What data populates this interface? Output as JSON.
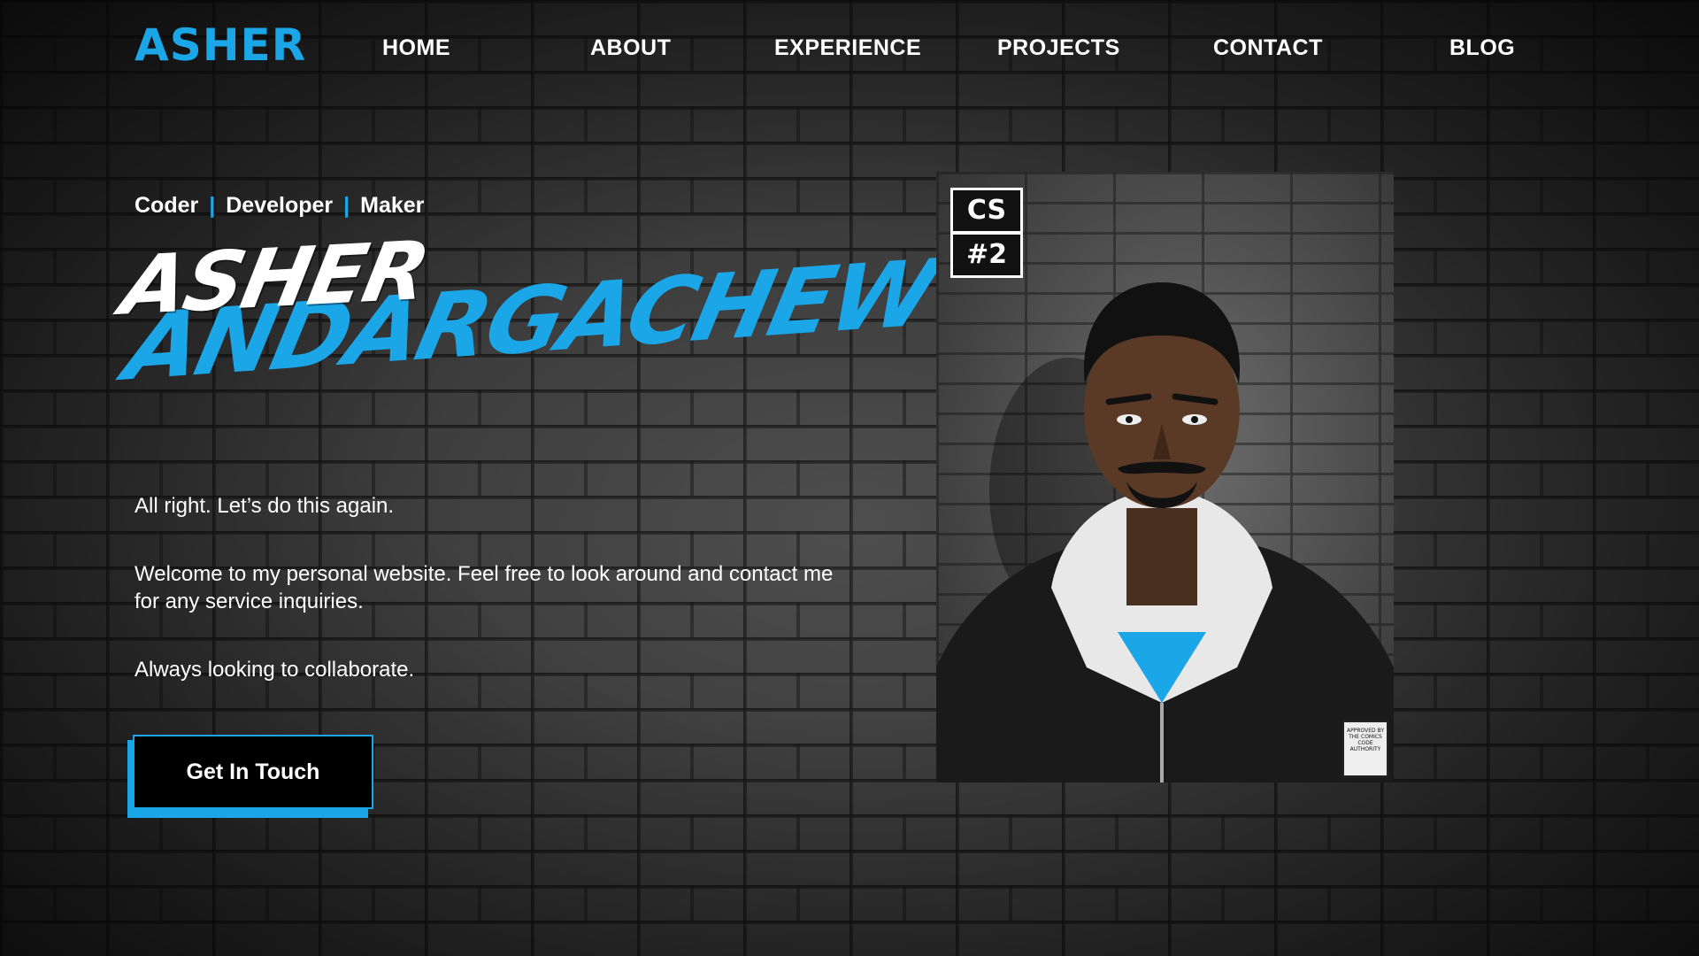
{
  "nav": {
    "logo": "ASHER",
    "items": [
      "HOME",
      "ABOUT",
      "EXPERIENCE",
      "PROJECTS",
      "CONTACT",
      "BLOG"
    ]
  },
  "hero": {
    "tagline": [
      "Coder",
      "Developer",
      "Maker"
    ],
    "first_name": "ASHER",
    "last_name": "ANDARGACHEW",
    "paragraphs": [
      "All right. Let’s do this again.",
      "Welcome to my personal website. Feel free to look around and contact me for any service inquiries.",
      "Always looking to collaborate."
    ],
    "cta_label": "Get In Touch"
  },
  "portrait": {
    "badge_top": "CS",
    "badge_bottom": "#2",
    "seal_text": "APPROVED BY THE COMICS CODE AUTHORITY",
    "icon": "person-portrait-icon"
  },
  "colors": {
    "accent": "#1ba6e8",
    "background": "#3a3a3a",
    "button": "#000000"
  }
}
